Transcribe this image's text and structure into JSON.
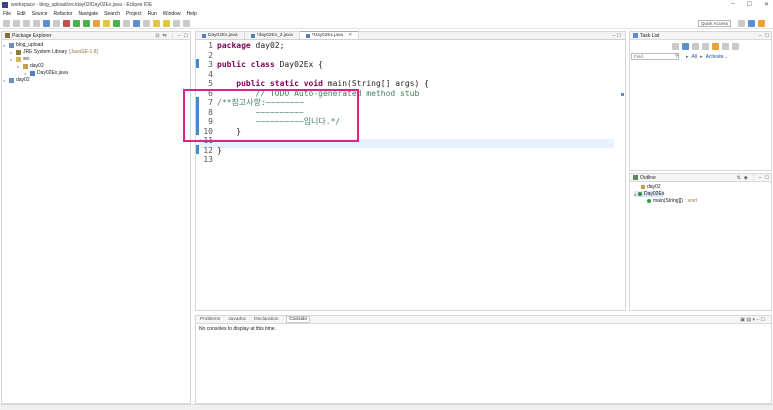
{
  "window": {
    "title": "workspace - blog_upload/src/day02/Day02Ex.java - Eclipse IDE",
    "controls": {
      "minimize": "–",
      "maximize": "☐",
      "close": "✕"
    }
  },
  "menu": [
    "File",
    "Edit",
    "Source",
    "Refactor",
    "Navigate",
    "Search",
    "Project",
    "Run",
    "Window",
    "Help"
  ],
  "toolbar": {
    "quick_access": "Quick Access"
  },
  "package_explorer": {
    "title": "Package Explorer",
    "items": [
      {
        "label": "blog_upload",
        "indent": 0,
        "twisty": "v"
      },
      {
        "label": "JRE System Library",
        "suffix": "[JavaSE-1.8]",
        "indent": 1,
        "twisty": ">"
      },
      {
        "label": "src",
        "indent": 1,
        "twisty": "v"
      },
      {
        "label": "day02",
        "indent": 2,
        "twisty": "v"
      },
      {
        "label": "Day02Ex.java",
        "indent": 3,
        "twisty": ">"
      },
      {
        "label": "day02",
        "indent": 0,
        "twisty": ">"
      }
    ]
  },
  "editor": {
    "tabs": [
      {
        "label": "Day02Ex.java",
        "active": false
      },
      {
        "label": "*day02Ex_2.java",
        "active": false
      },
      {
        "label": "*Day02Ex.java",
        "active": true
      }
    ],
    "lines": [
      {
        "n": "1",
        "text": "package day02;"
      },
      {
        "n": "2",
        "text": ""
      },
      {
        "n": "3",
        "text": "public class Day02Ex {"
      },
      {
        "n": "4",
        "text": ""
      },
      {
        "n": "5",
        "text": "    public static void main(String[] args) {"
      },
      {
        "n": "6",
        "text": "        // TODO Auto-generated method stub"
      },
      {
        "n": "7",
        "text": "/**참고사항:~~~~~~~~"
      },
      {
        "n": "8",
        "text": "        ~~~~~~~~~~"
      },
      {
        "n": "9",
        "text": "        ~~~~~~~~~~입니다.*/"
      },
      {
        "n": "10",
        "text": "    }"
      },
      {
        "n": "11",
        "text": ""
      },
      {
        "n": "12",
        "text": "}"
      },
      {
        "n": "13",
        "text": ""
      }
    ]
  },
  "task_list": {
    "title": "Task List",
    "search_placeholder": "Find",
    "all_label": "All",
    "activate_label": "Activate..."
  },
  "outline": {
    "title": "Outline",
    "items": [
      {
        "label": "day02",
        "indent": 0
      },
      {
        "label": "Day02Ex",
        "indent": 0
      },
      {
        "label": "main(String[])",
        "suffix": ": void",
        "indent": 1
      }
    ]
  },
  "bottom_panel": {
    "tabs": [
      "Problems",
      "Javadoc",
      "Declaration",
      "Console"
    ],
    "active_tab": "Console",
    "message": "No consoles to display at this time."
  },
  "colors": {
    "keyword": "#7f0055",
    "comment": "#3f7f5f",
    "annotation_box": "#e0218a",
    "current_line": "#e8f2fe"
  }
}
